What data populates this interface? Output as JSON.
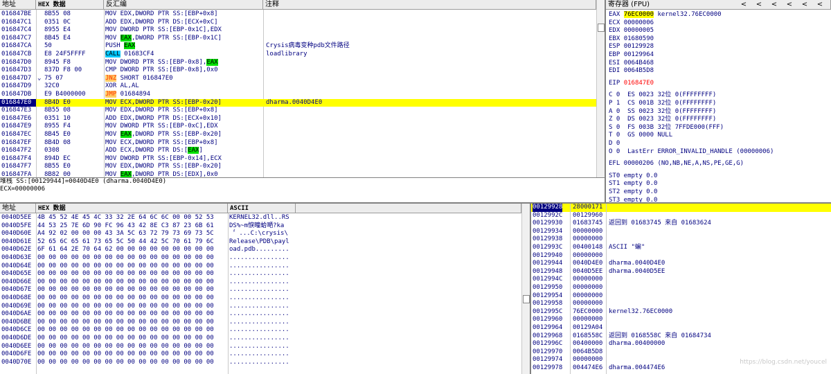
{
  "disasm": {
    "headers": {
      "address": "地址",
      "hex": "HEX 数据",
      "disasm": "反汇编",
      "comment": "注释"
    },
    "rows": [
      {
        "addr": "016847BE",
        "hex": "8B55 08",
        "arrow": "",
        "dis": "MOV EDX,DWORD PTR SS:[EBP+0x8]",
        "cmt": ""
      },
      {
        "addr": "016847C1",
        "hex": "0351 0C",
        "arrow": "",
        "dis": "ADD EDX,DWORD PTR DS:[ECX+0xC]",
        "cmt": ""
      },
      {
        "addr": "016847C4",
        "hex": "8955 E4",
        "arrow": "",
        "dis": "MOV DWORD PTR SS:[EBP-0x1C],EDX",
        "cmt": ""
      },
      {
        "addr": "016847C7",
        "hex": "8B45 E4",
        "arrow": "",
        "dis": "MOV EAX,DWORD PTR SS:[EBP-0x1C]",
        "cmt": ""
      },
      {
        "addr": "016847CA",
        "hex": "50",
        "arrow": "",
        "dis": "PUSH EAX",
        "cmt": "Crysis病毒变种pdb文件路径"
      },
      {
        "addr": "016847CB",
        "hex": "E8 24F5FFFF",
        "arrow": "",
        "dis": "CALL 01683CF4",
        "cmt": "loadlibrary"
      },
      {
        "addr": "016847D0",
        "hex": "8945 F8",
        "arrow": "",
        "dis": "MOV DWORD PTR SS:[EBP-0x8],EAX",
        "cmt": ""
      },
      {
        "addr": "016847D3",
        "hex": "837D F8 00",
        "arrow": "",
        "dis": "CMP DWORD PTR SS:[EBP-0x8],0x0",
        "cmt": ""
      },
      {
        "addr": "016847D7",
        "hex": "75 07",
        "arrow": "⌄",
        "dis": "JNZ SHORT 016847E0",
        "cmt": ""
      },
      {
        "addr": "016847D9",
        "hex": "32C0",
        "arrow": "",
        "dis": "XOR AL,AL",
        "cmt": ""
      },
      {
        "addr": "016847DB",
        "hex": "E9 B4000000",
        "arrow": "",
        "dis": "JMP 01684894",
        "cmt": ""
      },
      {
        "addr": "016847E0",
        "hex": "8B4D E0",
        "arrow": "",
        "dis": "MOV ECX,DWORD PTR SS:[EBP-0x20]",
        "cmt": "dharma.0040D4E0"
      },
      {
        "addr": "016847E3",
        "hex": "8B55 08",
        "arrow": "",
        "dis": "MOV EDX,DWORD PTR SS:[EBP+0x8]",
        "cmt": ""
      },
      {
        "addr": "016847E6",
        "hex": "0351 10",
        "arrow": "",
        "dis": "ADD EDX,DWORD PTR DS:[ECX+0x10]",
        "cmt": ""
      },
      {
        "addr": "016847E9",
        "hex": "8955 F4",
        "arrow": "",
        "dis": "MOV DWORD PTR SS:[EBP-0xC],EDX",
        "cmt": ""
      },
      {
        "addr": "016847EC",
        "hex": "8B45 E0",
        "arrow": "",
        "dis": "MOV EAX,DWORD PTR SS:[EBP-0x20]",
        "cmt": ""
      },
      {
        "addr": "016847EF",
        "hex": "8B4D 08",
        "arrow": "",
        "dis": "MOV ECX,DWORD PTR SS:[EBP+0x8]",
        "cmt": ""
      },
      {
        "addr": "016847F2",
        "hex": "0308",
        "arrow": "",
        "dis": "ADD ECX,DWORD PTR DS:[EAX]",
        "cmt": ""
      },
      {
        "addr": "016847F4",
        "hex": "894D EC",
        "arrow": "",
        "dis": "MOV DWORD PTR SS:[EBP-0x14],ECX",
        "cmt": ""
      },
      {
        "addr": "016847F7",
        "hex": "8B55 E0",
        "arrow": "",
        "dis": "MOV EDX,DWORD PTR SS:[EBP-0x20]",
        "cmt": ""
      },
      {
        "addr": "016847FA",
        "hex": "8B82 00",
        "arrow": "",
        "dis": "MOV EAX,DWORD PTR DS:[EDX],0x0",
        "cmt": ""
      }
    ],
    "selected_index": 11
  },
  "info_pane": {
    "line1": "堆栈 SS:[00129944]=0040D4E0 (dharma.0040D4E0)",
    "line2": "ECX=00000006"
  },
  "registers": {
    "header": "寄存器 (FPU)",
    "nav": [
      "<",
      "<",
      "<",
      "<",
      "<",
      "<"
    ],
    "gp": [
      {
        "name": "EAX",
        "val": "76EC0000",
        "note": "kernel32.76EC0000"
      },
      {
        "name": "ECX",
        "val": "00000006",
        "note": ""
      },
      {
        "name": "EDX",
        "val": "00000005",
        "note": ""
      },
      {
        "name": "EBX",
        "val": "01680590",
        "note": ""
      },
      {
        "name": "ESP",
        "val": "00129928",
        "note": ""
      },
      {
        "name": "EBP",
        "val": "00129964",
        "note": ""
      },
      {
        "name": "ESI",
        "val": "0064B468",
        "note": ""
      },
      {
        "name": "EDI",
        "val": "0064B5D8",
        "note": ""
      }
    ],
    "eip": {
      "name": "EIP",
      "val": "016847E0"
    },
    "flags": [
      "C 0  ES 0023 32位 0(FFFFFFFF)",
      "P 1  CS 001B 32位 0(FFFFFFFF)",
      "A 0  SS 0023 32位 0(FFFFFFFF)",
      "Z 0  DS 0023 32位 0(FFFFFFFF)",
      "S 0  FS 003B 32位 7FFDE000(FFF)",
      "T 0  GS 0000 NULL",
      "D 0",
      "O 0  LastErr ERROR_INVALID_HANDLE (00000006)"
    ],
    "efl": "EFL 00000206 (NO,NB,NE,A,NS,PE,GE,G)",
    "fpu": [
      "ST0 empty 0.0",
      "ST1 empty 0.0",
      "ST2 empty 0.0",
      "ST3 empty 0.0"
    ]
  },
  "dump": {
    "headers": {
      "address": "地址",
      "hex": "HEX 数据",
      "ascii": "ASCII"
    },
    "rows": [
      {
        "addr": "0040D5EE",
        "hex": "4B 45 52 4E 45 4C 33 32 2E 64 6C 6C 00 00 52 53",
        "asc": "KERNEL32.dll..RS"
      },
      {
        "addr": "0040D5FE",
        "hex": "44 53 25 7E 6D 90 FC 96 43 42 8E C3 87 23 6B 61",
        "asc": "DS%~m悷疃蛤嗮?ka"
      },
      {
        "addr": "0040D60E",
        "hex": "A4 92 02 00 00 00 43 3A 5C 63 72 79 73 69 73 5C",
        "asc": " 〞...C:\\crysis\\"
      },
      {
        "addr": "0040D61E",
        "hex": "52 65 6C 65 61 73 65 5C 50 44 42 5C 70 61 79 6C",
        "asc": "Release\\PDB\\payl"
      },
      {
        "addr": "0040D62E",
        "hex": "6F 61 64 2E 70 64 62 00 00 00 00 00 00 00 00 00",
        "asc": "oad.pdb........."
      },
      {
        "addr": "0040D63E",
        "hex": "00 00 00 00 00 00 00 00 00 00 00 00 00 00 00 00",
        "asc": "................"
      },
      {
        "addr": "0040D64E",
        "hex": "00 00 00 00 00 00 00 00 00 00 00 00 00 00 00 00",
        "asc": "................"
      },
      {
        "addr": "0040D65E",
        "hex": "00 00 00 00 00 00 00 00 00 00 00 00 00 00 00 00",
        "asc": "................"
      },
      {
        "addr": "0040D66E",
        "hex": "00 00 00 00 00 00 00 00 00 00 00 00 00 00 00 00",
        "asc": "................"
      },
      {
        "addr": "0040D67E",
        "hex": "00 00 00 00 00 00 00 00 00 00 00 00 00 00 00 00",
        "asc": "................"
      },
      {
        "addr": "0040D68E",
        "hex": "00 00 00 00 00 00 00 00 00 00 00 00 00 00 00 00",
        "asc": "................"
      },
      {
        "addr": "0040D69E",
        "hex": "00 00 00 00 00 00 00 00 00 00 00 00 00 00 00 00",
        "asc": "................"
      },
      {
        "addr": "0040D6AE",
        "hex": "00 00 00 00 00 00 00 00 00 00 00 00 00 00 00 00",
        "asc": "................"
      },
      {
        "addr": "0040D6BE",
        "hex": "00 00 00 00 00 00 00 00 00 00 00 00 00 00 00 00",
        "asc": "................"
      },
      {
        "addr": "0040D6CE",
        "hex": "00 00 00 00 00 00 00 00 00 00 00 00 00 00 00 00",
        "asc": "................"
      },
      {
        "addr": "0040D6DE",
        "hex": "00 00 00 00 00 00 00 00 00 00 00 00 00 00 00 00",
        "asc": "................"
      },
      {
        "addr": "0040D6EE",
        "hex": "00 00 00 00 00 00 00 00 00 00 00 00 00 00 00 00",
        "asc": "................"
      },
      {
        "addr": "0040D6FE",
        "hex": "00 00 00 00 00 00 00 00 00 00 00 00 00 00 00 00",
        "asc": "................"
      },
      {
        "addr": "0040D70E",
        "hex": "00 00 00 00 00 00 00 00 00 00 00 00 00 00 00 00",
        "asc": "................"
      }
    ]
  },
  "stack": {
    "rows": [
      {
        "addr": "00129928",
        "val": "28000171",
        "cmt": ""
      },
      {
        "addr": "0012992C",
        "val": "00129960",
        "cmt": ""
      },
      {
        "addr": "00129930",
        "val": "01683745",
        "cmt": "返回到 01683745 来自 01683624"
      },
      {
        "addr": "00129934",
        "val": "00000000",
        "cmt": ""
      },
      {
        "addr": "00129938",
        "val": "00000000",
        "cmt": ""
      },
      {
        "addr": "0012993C",
        "val": "00400148",
        "cmt": "ASCII \"蝙\""
      },
      {
        "addr": "00129940",
        "val": "00000000",
        "cmt": ""
      },
      {
        "addr": "00129944",
        "val": "0040D4E0",
        "cmt": "dharma.0040D4E0"
      },
      {
        "addr": "00129948",
        "val": "0040D5EE",
        "cmt": "dharma.0040D5EE"
      },
      {
        "addr": "0012994C",
        "val": "00000000",
        "cmt": ""
      },
      {
        "addr": "00129950",
        "val": "00000000",
        "cmt": ""
      },
      {
        "addr": "00129954",
        "val": "00000000",
        "cmt": ""
      },
      {
        "addr": "00129958",
        "val": "00000000",
        "cmt": ""
      },
      {
        "addr": "0012995C",
        "val": "76EC0000",
        "cmt": "kernel32.76EC0000"
      },
      {
        "addr": "00129960",
        "val": "00000000",
        "cmt": ""
      },
      {
        "addr": "00129964",
        "val": "00129A04",
        "cmt": ""
      },
      {
        "addr": "00129968",
        "val": "0168558C",
        "cmt": "返回到 0168558C 来自 01684734"
      },
      {
        "addr": "0012996C",
        "val": "00400000",
        "cmt": "dharma.00400000"
      },
      {
        "addr": "00129970",
        "val": "0064B5D8",
        "cmt": ""
      },
      {
        "addr": "00129974",
        "val": "00000000",
        "cmt": ""
      },
      {
        "addr": "00129978",
        "val": "004474E6",
        "cmt": "dharma.004474E6"
      }
    ],
    "selected_index": 0
  },
  "watermark": "https://blog.csdn.net/youcel"
}
